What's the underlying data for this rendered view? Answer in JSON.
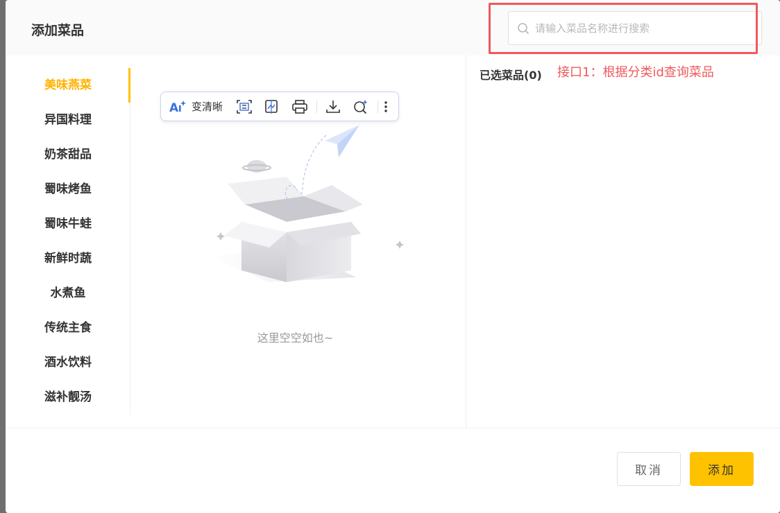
{
  "dialog": {
    "title": "添加菜品",
    "search": {
      "placeholder": "请输入菜品名称进行搜索",
      "value": ""
    },
    "annotation": "接口1：根据分类id查询菜品"
  },
  "categories": [
    {
      "label": "美味燕菜",
      "active": true
    },
    {
      "label": "异国料理",
      "active": false
    },
    {
      "label": "奶茶甜品",
      "active": false
    },
    {
      "label": "蜀味烤鱼",
      "active": false
    },
    {
      "label": "蜀味牛蛙",
      "active": false
    },
    {
      "label": "新鲜时蔬",
      "active": false
    },
    {
      "label": "水煮鱼",
      "active": false
    },
    {
      "label": "传统主食",
      "active": false
    },
    {
      "label": "酒水饮料",
      "active": false
    },
    {
      "label": "滋补靓汤",
      "active": false
    }
  ],
  "image_toolbar": {
    "ai_label": "变清晰",
    "icons": [
      "ai-sparkle-icon",
      "ocr-icon",
      "image-edit-icon",
      "print-icon",
      "download-icon",
      "ai-search-icon",
      "more-icon"
    ]
  },
  "empty": {
    "text": "这里空空如也~"
  },
  "selected": {
    "title": "已选菜品(0)"
  },
  "footer": {
    "cancel_label": "取消",
    "add_label": "添加"
  },
  "colors": {
    "accent": "#ffc200",
    "active_text": "#ffb302",
    "annotation": "#f0585a"
  }
}
